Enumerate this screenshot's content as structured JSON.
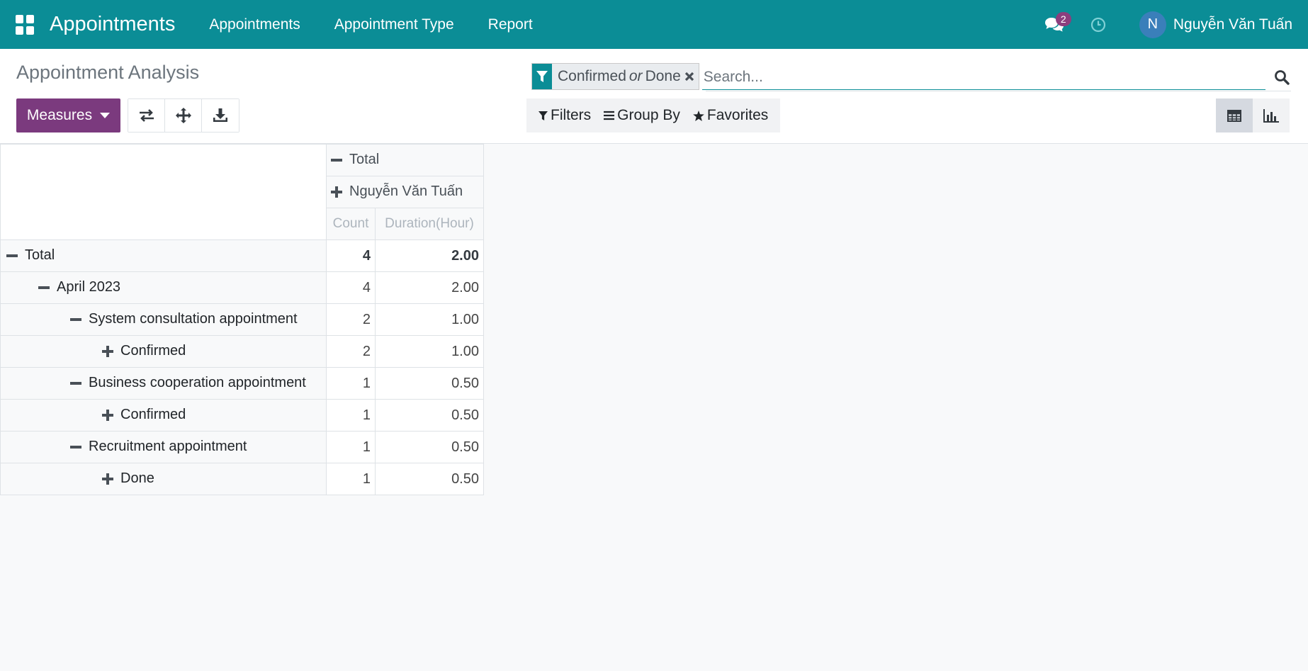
{
  "navbar": {
    "app_title": "Appointments",
    "menu": [
      "Appointments",
      "Appointment Type",
      "Report"
    ],
    "messages_count": "2",
    "user_initial": "N",
    "user_name": "Nguyễn Văn Tuấn",
    "color": "#0b8d96"
  },
  "control": {
    "page_title": "Appointment Analysis",
    "measures_label": "Measures",
    "search": {
      "facet_parts": [
        "Confirmed",
        "or",
        "Done"
      ],
      "placeholder": "Search..."
    },
    "filters_label": "Filters",
    "group_by_label": "Group By",
    "favorites_label": "Favorites",
    "views": [
      "pivot",
      "graph"
    ],
    "active_view": "pivot"
  },
  "pivot": {
    "col_header_total": "Total",
    "col_header_user": "Nguyễn Văn Tuấn",
    "measures": [
      "Count",
      "Duration(Hour)"
    ],
    "rows": [
      {
        "label": "Total",
        "toggle": "minus",
        "count": "4",
        "duration": "2.00",
        "bold": true
      },
      {
        "label": "April 2023",
        "toggle": "minus",
        "count": "4",
        "duration": "2.00"
      },
      {
        "label": "System consultation appointment",
        "toggle": "minus",
        "count": "2",
        "duration": "1.00"
      },
      {
        "label": "Confirmed",
        "toggle": "plus",
        "count": "2",
        "duration": "1.00"
      },
      {
        "label": "Business cooperation appointment",
        "toggle": "minus",
        "count": "1",
        "duration": "0.50"
      },
      {
        "label": "Confirmed",
        "toggle": "plus",
        "count": "1",
        "duration": "0.50"
      },
      {
        "label": "Recruitment appointment",
        "toggle": "minus",
        "count": "1",
        "duration": "0.50"
      },
      {
        "label": "Done",
        "toggle": "plus",
        "count": "1",
        "duration": "0.50"
      }
    ]
  }
}
